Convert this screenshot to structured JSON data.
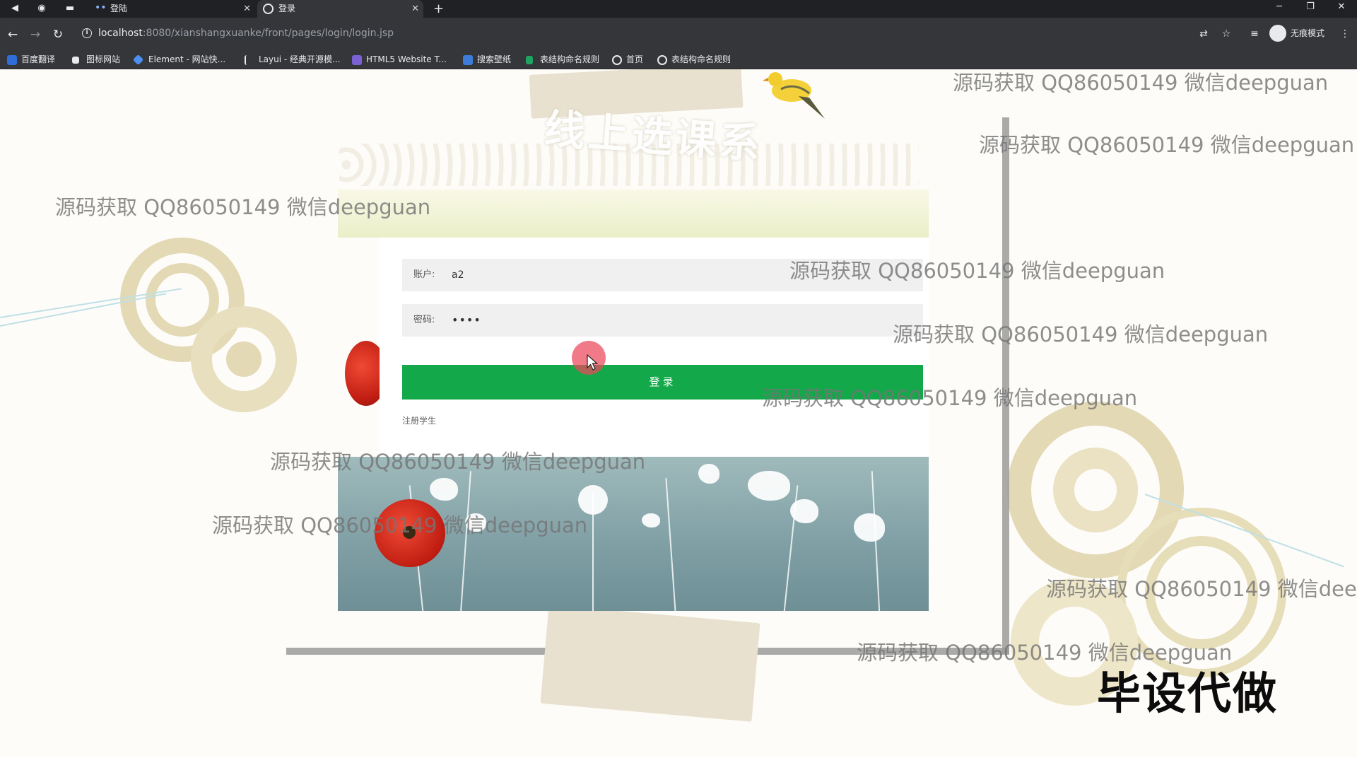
{
  "browser": {
    "tabs": [
      {
        "label": "登陆"
      },
      {
        "label": "登录"
      }
    ],
    "new_tab_symbol": "+",
    "url_host": "localhost",
    "url_rest": ":8080/xianshangxuanke/front/pages/login/login.jsp",
    "profile_label": "无痕模式",
    "bookmarks": [
      {
        "label": "百度翻译",
        "color": "#2f6ed8"
      },
      {
        "label": "图标网站",
        "color": "#e8eaed"
      },
      {
        "label": "Element - 网站快...",
        "color": "#4b8ff0"
      },
      {
        "label": "Layui - 经典开源模...",
        "color": "#e8eaed"
      },
      {
        "label": "HTML5 Website T...",
        "color": "#7a62d6"
      },
      {
        "label": "搜索壁纸",
        "color": "#3b7dd8"
      },
      {
        "label": "表结构命名规则",
        "color": "#1fa463"
      },
      {
        "label": "首页",
        "color": "#e8eaed"
      },
      {
        "label": "表结构命名规则",
        "color": "#e8eaed"
      }
    ]
  },
  "page": {
    "banner_title": "线上选课系",
    "account_label": "账户:",
    "account_value": "a2",
    "password_label": "密码:",
    "password_value": "••••",
    "login_button": "登录",
    "register_link": "注册学生"
  },
  "overlay": {
    "watermark_text": "源码获取 QQ86050149 微信deepguan",
    "stamp_text": "毕设代做"
  },
  "colors": {
    "login_button": "#13a84a",
    "chrome_dark": "#202124",
    "chrome_bar": "#35363a"
  }
}
